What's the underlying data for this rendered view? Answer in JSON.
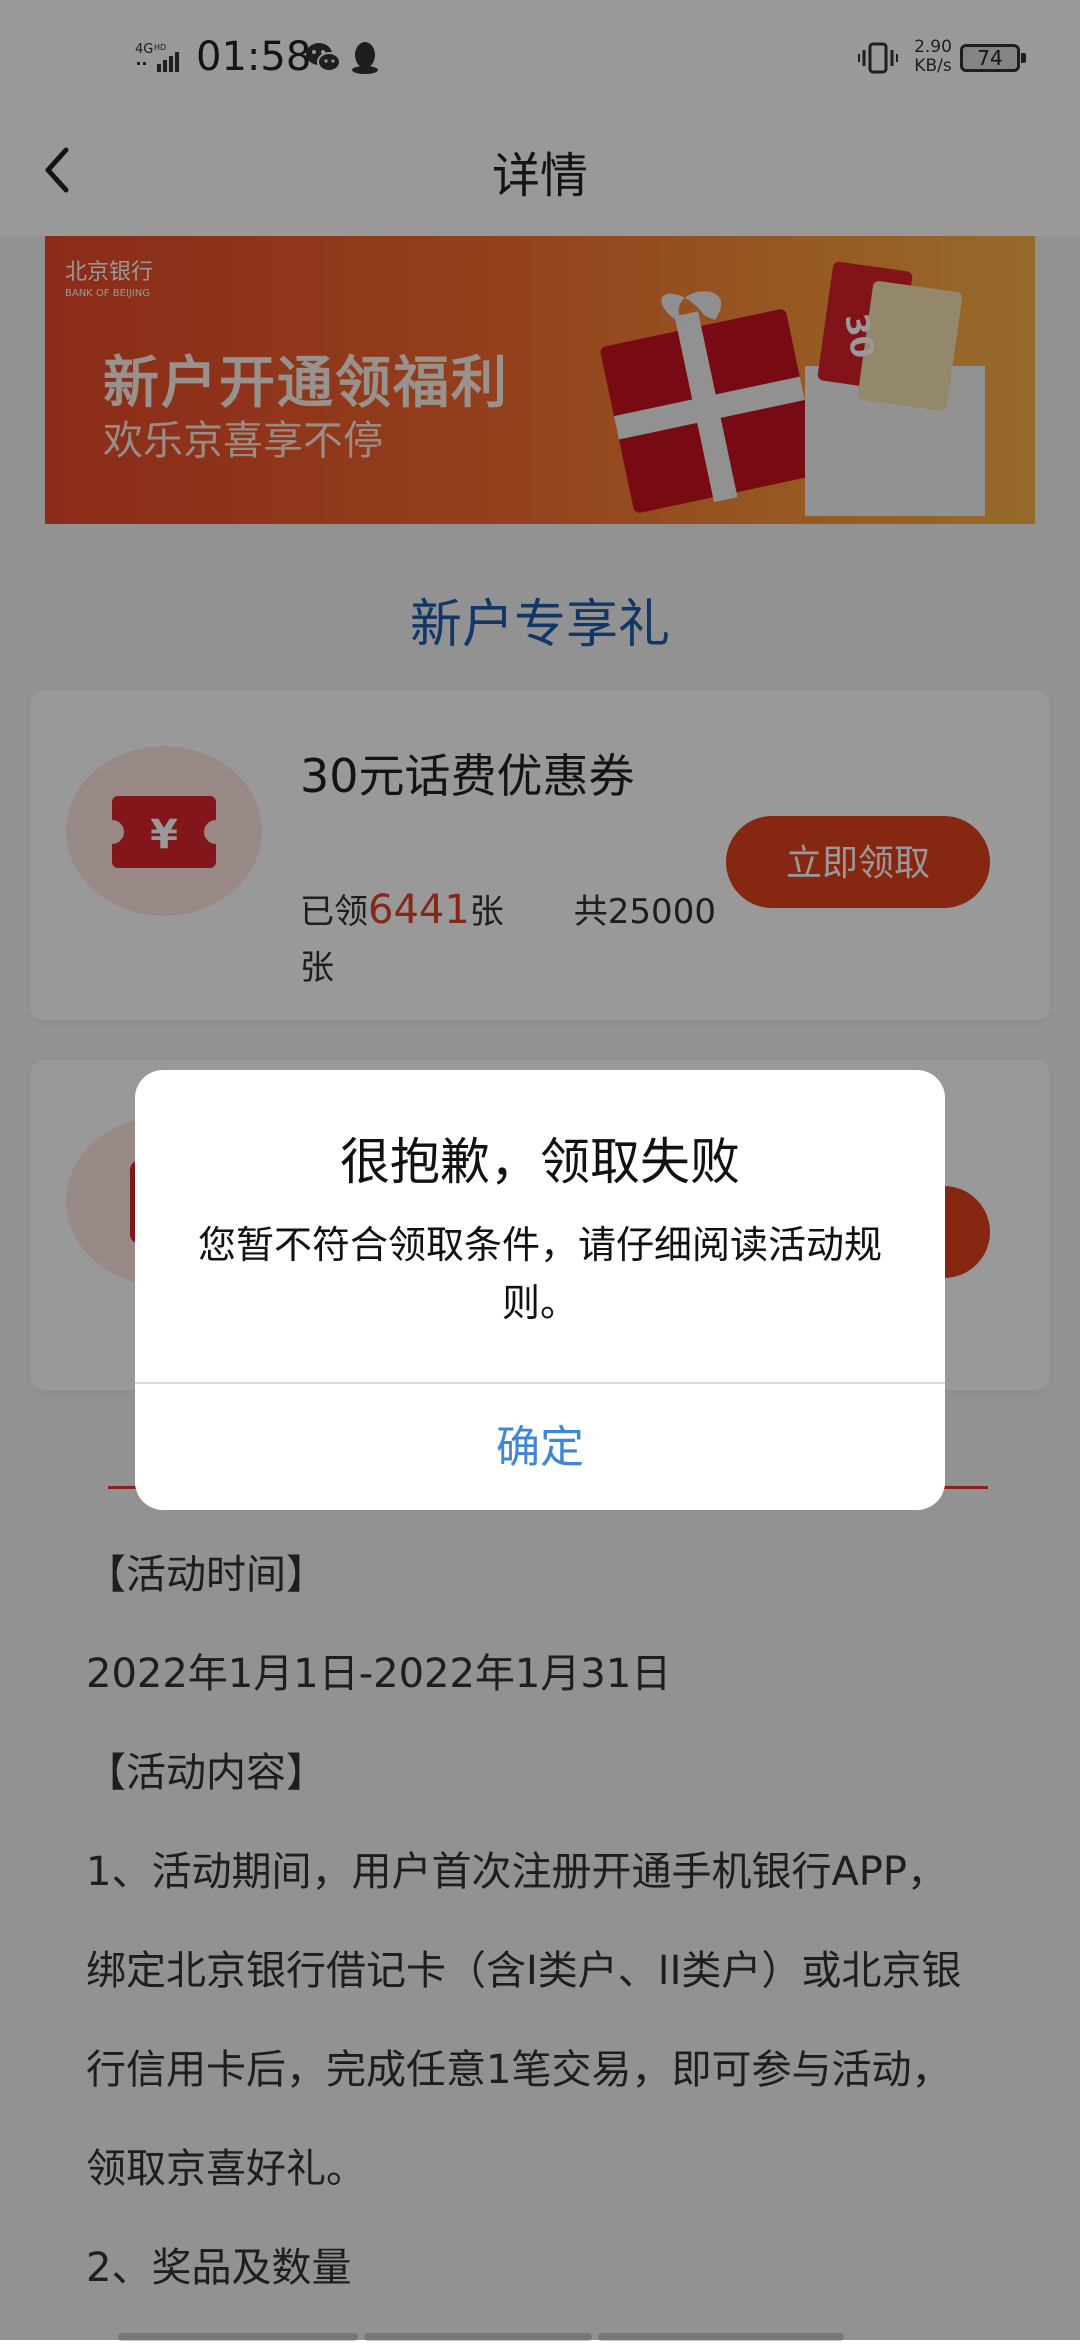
{
  "status_bar": {
    "network": "4GHD",
    "time": "01:58",
    "speed_value": "2.90",
    "speed_unit": "KB/s",
    "battery": "74"
  },
  "nav": {
    "title": "详情"
  },
  "banner": {
    "logo": "北京银行",
    "logo_en": "BANK OF BEIJING",
    "title": "新户开通领福利",
    "subtitle": "欢乐京喜享不停"
  },
  "section": {
    "title": "新户专享礼"
  },
  "coupons": [
    {
      "name": "30元话费优惠券",
      "claimed_prefix": "已领",
      "claimed": "6441",
      "unit": "张",
      "total": "共25000",
      "button": "立即领取"
    }
  ],
  "rules": [
    "【活动时间】",
    "2022年1月1日-2022年1月31日",
    "【活动内容】",
    "1、活动期间，用户首次注册开通手机银行APP，绑定北京银行借记卡（含I类户、II类户）或北京银行信用卡后，完成任意1笔交易，即可参与活动，领取京喜好礼。",
    "2、奖品及数量"
  ],
  "dialog": {
    "title": "很抱歉，领取失败",
    "message": "您暂不符合领取条件，请仔细阅读活动规则。",
    "confirm": "确定"
  },
  "colors": {
    "accent_red": "#e0411f",
    "section_blue": "#1f5aa8",
    "dialog_button_blue": "#3f86d6"
  }
}
